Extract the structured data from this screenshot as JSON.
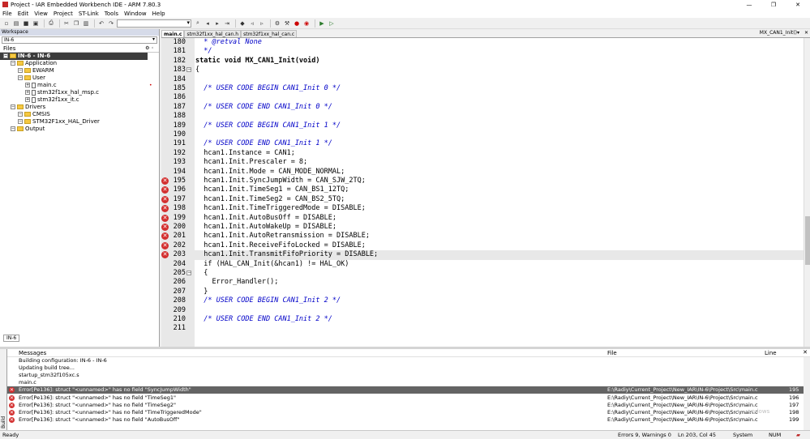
{
  "window": {
    "title": "Project - IAR Embedded Workbench IDE - ARM 7.80.3"
  },
  "menu": [
    "File",
    "Edit",
    "View",
    "Project",
    "ST-Link",
    "Tools",
    "Window",
    "Help"
  ],
  "workspace": {
    "header": "Workspace",
    "config": "IN-6",
    "files_label": "Files",
    "tree": [
      {
        "label": "IN-6 - IN-6",
        "level": 0,
        "kind": "project",
        "selected": true
      },
      {
        "label": "Application",
        "level": 1,
        "kind": "folder"
      },
      {
        "label": "EWARM",
        "level": 2,
        "kind": "folder"
      },
      {
        "label": "User",
        "level": 2,
        "kind": "folder"
      },
      {
        "label": "main.c",
        "level": 3,
        "kind": "file",
        "modified": true
      },
      {
        "label": "stm32f1xx_hal_msp.c",
        "level": 3,
        "kind": "file"
      },
      {
        "label": "stm32f1xx_it.c",
        "level": 3,
        "kind": "file"
      },
      {
        "label": "Drivers",
        "level": 1,
        "kind": "folder"
      },
      {
        "label": "CMSIS",
        "level": 2,
        "kind": "folder"
      },
      {
        "label": "STM32F1xx_HAL_Driver",
        "level": 2,
        "kind": "folder"
      },
      {
        "label": "Output",
        "level": 1,
        "kind": "folder"
      }
    ],
    "bottom_tab": "IN-6"
  },
  "editor": {
    "tabs": [
      "main.c",
      "stm32f1xx_hal_can.h",
      "stm32f1xx_hal_can.c"
    ],
    "active_tab": 0,
    "function": "MX_CAN1_Init()",
    "lines": [
      {
        "n": "180",
        "t": "  * @retval None",
        "s": "cm"
      },
      {
        "n": "181",
        "t": "  */",
        "s": "cm"
      },
      {
        "n": "182",
        "t": "static void MX_CAN1_Init(void)",
        "s": "kw"
      },
      {
        "n": "183",
        "t": "{",
        "s": "",
        "fold": true
      },
      {
        "n": "184",
        "t": "",
        "s": ""
      },
      {
        "n": "185",
        "t": "  /* USER CODE BEGIN CAN1_Init 0 */",
        "s": "cm"
      },
      {
        "n": "186",
        "t": "",
        "s": ""
      },
      {
        "n": "187",
        "t": "  /* USER CODE END CAN1_Init 0 */",
        "s": "cm"
      },
      {
        "n": "188",
        "t": "",
        "s": ""
      },
      {
        "n": "189",
        "t": "  /* USER CODE BEGIN CAN1_Init 1 */",
        "s": "cm"
      },
      {
        "n": "190",
        "t": "",
        "s": ""
      },
      {
        "n": "191",
        "t": "  /* USER CODE END CAN1_Init 1 */",
        "s": "cm"
      },
      {
        "n": "192",
        "t": "  hcan1.Instance = CAN1;",
        "s": ""
      },
      {
        "n": "193",
        "t": "  hcan1.Init.Prescaler = 8;",
        "s": ""
      },
      {
        "n": "194",
        "t": "  hcan1.Init.Mode = CAN_MODE_NORMAL;",
        "s": ""
      },
      {
        "n": "195",
        "t": "  hcan1.Init.SyncJumpWidth = CAN_SJW_2TQ;",
        "s": "",
        "err": true
      },
      {
        "n": "196",
        "t": "  hcan1.Init.TimeSeg1 = CAN_BS1_12TQ;",
        "s": "",
        "err": true
      },
      {
        "n": "197",
        "t": "  hcan1.Init.TimeSeg2 = CAN_BS2_5TQ;",
        "s": "",
        "err": true
      },
      {
        "n": "198",
        "t": "  hcan1.Init.TimeTriggeredMode = DISABLE;",
        "s": "",
        "err": true
      },
      {
        "n": "199",
        "t": "  hcan1.Init.AutoBusOff = DISABLE;",
        "s": "",
        "err": true
      },
      {
        "n": "200",
        "t": "  hcan1.Init.AutoWakeUp = DISABLE;",
        "s": "",
        "err": true
      },
      {
        "n": "201",
        "t": "  hcan1.Init.AutoRetransmission = DISABLE;",
        "s": "",
        "err": true
      },
      {
        "n": "202",
        "t": "  hcan1.Init.ReceiveFifoLocked = DISABLE;",
        "s": "",
        "err": true
      },
      {
        "n": "203",
        "t": "  hcan1.Init.TransmitFifoPriority = DISABLE;",
        "s": "",
        "err": true,
        "current": true
      },
      {
        "n": "204",
        "t": "  if (HAL_CAN_Init(&hcan1) != HAL_OK)",
        "s": ""
      },
      {
        "n": "205",
        "t": "  {",
        "s": "",
        "fold": true
      },
      {
        "n": "206",
        "t": "    Error_Handler();",
        "s": ""
      },
      {
        "n": "207",
        "t": "  }",
        "s": ""
      },
      {
        "n": "208",
        "t": "  /* USER CODE BEGIN CAN1_Init 2 */",
        "s": "cm"
      },
      {
        "n": "209",
        "t": "",
        "s": ""
      },
      {
        "n": "210",
        "t": "  /* USER CODE END CAN1_Init 2 */",
        "s": "cm"
      },
      {
        "n": "211",
        "t": "",
        "s": ""
      }
    ]
  },
  "messages": {
    "tab": "Build",
    "col_messages": "Messages",
    "col_file": "File",
    "col_line": "Line",
    "rows": [
      {
        "text": "Building configuration: IN-6 - IN-6",
        "file": "",
        "line": "",
        "error": false
      },
      {
        "text": "Updating build tree...",
        "file": "",
        "line": "",
        "error": false
      },
      {
        "text": "startup_stm32f105xc.s",
        "file": "",
        "line": "",
        "error": false
      },
      {
        "text": "main.c",
        "file": "",
        "line": "",
        "error": false
      },
      {
        "text": "Error[Pe136]: struct \"<unnamed>\" has no field \"SyncJumpWidth\"",
        "file": "E:\\Radiy\\Current_Project\\New_IAR\\IN-6\\Project\\Src\\main.c",
        "line": "195",
        "error": true,
        "highlight": true
      },
      {
        "text": "Error[Pe136]: struct \"<unnamed>\" has no field \"TimeSeg1\"",
        "file": "E:\\Radiy\\Current_Project\\New_IAR\\IN-6\\Project\\Src\\main.c",
        "line": "196",
        "error": true
      },
      {
        "text": "Error[Pe136]: struct \"<unnamed>\" has no field \"TimeSeg2\"",
        "file": "E:\\Radiy\\Current_Project\\New_IAR\\IN-6\\Project\\Src\\main.c",
        "line": "197",
        "error": true
      },
      {
        "text": "Error[Pe136]: struct \"<unnamed>\" has no field \"TimeTriggeredMode\"",
        "file": "E:\\Radiy\\Current_Project\\New_IAR\\IN-6\\Project\\Src\\main.c",
        "line": "198",
        "error": true
      },
      {
        "text": "Error[Pe136]: struct \"<unnamed>\" has no field \"AutoBusOff\"",
        "file": "E:\\Radiy\\Current_Project\\New_IAR\\IN-6\\Project\\Src\\main.c",
        "line": "199",
        "error": true
      }
    ]
  },
  "status": {
    "ready": "Ready",
    "errors": "Errors 9, Warnings 0",
    "position": "Ln 203, Col 45",
    "encoding": "System",
    "num": "NUM"
  },
  "watermark": "...ndows"
}
